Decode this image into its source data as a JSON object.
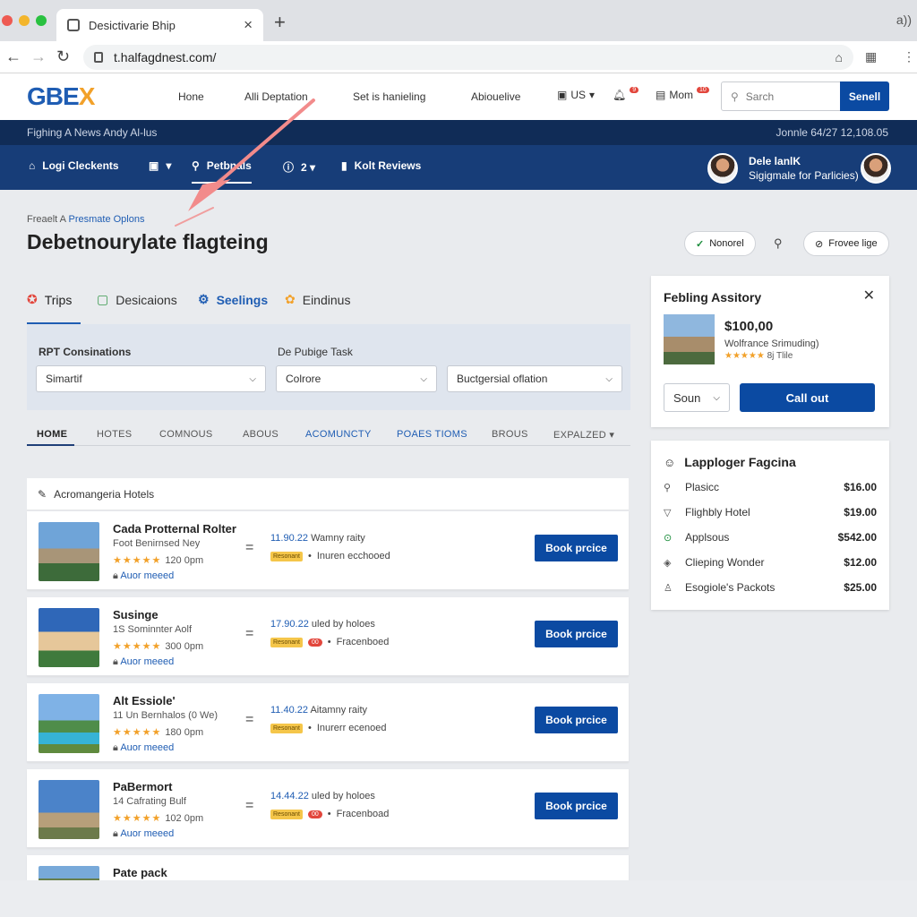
{
  "browser": {
    "tab_title": "Desictivarie Bhip",
    "tab_close": "×",
    "new_tab": "+",
    "tab_right_icon": "a))",
    "url": "t.halfagdnest.com/",
    "nav_back": "←",
    "nav_forward": "→",
    "nav_reload": "↻",
    "bookmark_icon": "⌂",
    "extension_icon": "▦"
  },
  "site": {
    "logo_part1": "GBE",
    "logo_part2": "X",
    "nav": [
      "Hone",
      "Alli Deptation",
      "Set is hanieling",
      "Abiouelive"
    ],
    "region": "US",
    "notif_badge": "9",
    "messages_label": "Mom",
    "messages_badge": "10",
    "search_placeholder": "Sarch",
    "search_button": "Senell"
  },
  "banner": {
    "left_text": "Fighing A News Andy Al-lus",
    "right_text": "Jonnle 64/27 12,108.05",
    "nav": [
      {
        "label": "Logi Cleckents",
        "icon": "home-icon"
      },
      {
        "label": "▾",
        "icon": "lock-icon"
      },
      {
        "label": "Petbnals",
        "icon": "search-icon"
      },
      {
        "label": "2 ▾",
        "icon": "info-icon"
      },
      {
        "label": "Kolt Reviews",
        "icon": "book-icon"
      }
    ],
    "user_name": "Dele lanlK",
    "user_sub": "Sigigmale for Parlicies)"
  },
  "page": {
    "breadcrumb_prefix": "Freaelt A",
    "breadcrumb_link": "Presmate Oplons",
    "title": "Debetnourylate flagteing",
    "pill_check": "✓",
    "pill_normal": "Nonorel",
    "search_icon": "⚲",
    "pill_preview": "Frovee lige"
  },
  "tabs": [
    {
      "label": "Trips"
    },
    {
      "label": "Desicaions"
    },
    {
      "label": "Seelings"
    },
    {
      "label": "Eindinus"
    }
  ],
  "filters": {
    "label1": "RPT Consinations",
    "label2": "De Pubige Task",
    "select1": "Simartif",
    "select2": "Colrore",
    "select3": "Buctgersial oflation"
  },
  "subtabs": [
    "HOME",
    "HOTES",
    "COMNOUS",
    "ABOUS",
    "ACOMUNCTY",
    "POAES TIOMS",
    "BROUS",
    "EXPALZED ▾"
  ],
  "list": {
    "header": "Acromangeria Hotels",
    "book_label": "Book prcice",
    "items": [
      {
        "title": "Cada Protternal Rolter",
        "sub": "Foot Benirnsed Ney",
        "stars": "★★★★★",
        "time": "120 0pm",
        "more": "Auor meeed",
        "info_hl": "11.90.22",
        "info": "Wamny raity",
        "tag": "Resonant",
        "red": "",
        "note": "Inuren ecchooed"
      },
      {
        "title": "Susinge",
        "sub": "1S Sominnter Aolf",
        "stars": "★★★★★",
        "time": "300 0pm",
        "more": "Auor meeed",
        "info_hl": "17.90.22",
        "info": "uled by holoes",
        "tag": "Resonant",
        "red": "00",
        "note": "Fracenboed"
      },
      {
        "title": "Alt Essiole'",
        "sub": "11 Un Bernhalos (0 We)",
        "stars": "★★★★★",
        "time": "180 0pm",
        "more": "Auor meeed",
        "info_hl": "11.40.22",
        "info": "Aitamny raity",
        "tag": "Resonant",
        "red": "",
        "note": "Inurerr ecenoed"
      },
      {
        "title": "PaBermort",
        "sub": "14 Cafrating Bulf",
        "stars": "★★★★★",
        "time": "102 0pm",
        "more": "Auor meeed",
        "info_hl": "14.44.22",
        "info": "uled by holoes",
        "tag": "Resonant",
        "red": "00",
        "note": "Fracenboad"
      },
      {
        "title": "Pate pack",
        "sub": "",
        "stars": "",
        "time": "",
        "more": "",
        "info_hl": "",
        "info": "",
        "tag": "",
        "red": "",
        "note": ""
      }
    ]
  },
  "sidebar_card": {
    "title": "Febling Assitory",
    "close": "✕",
    "price": "$100,00",
    "sub": "Wolfrance Srimuding)",
    "stars": "★★★★★",
    "stars_note": "8j Tlile",
    "select": "Soun",
    "button": "Call out"
  },
  "price_list": {
    "title": "Lapploger Fagcina",
    "rows": [
      {
        "label": "Plasicc",
        "value": "$16.00",
        "icon": "pin-icon"
      },
      {
        "label": "Flighbly Hotel",
        "value": "$19.00",
        "icon": "filter-icon"
      },
      {
        "label": "Applsous",
        "value": "$542.00",
        "icon": "circle-icon"
      },
      {
        "label": "Clieping Wonder",
        "value": "$12.00",
        "icon": "shield-icon"
      },
      {
        "label": "Esogiole's Packots",
        "value": "$25.00",
        "icon": "person-icon"
      }
    ]
  },
  "colors": {
    "brand_blue": "#0b4aa2",
    "banner_dark": "#102c57",
    "banner_mid": "#173d78",
    "logo_orange": "#f2a12a",
    "annotation_arrow": "#f28b8b"
  }
}
